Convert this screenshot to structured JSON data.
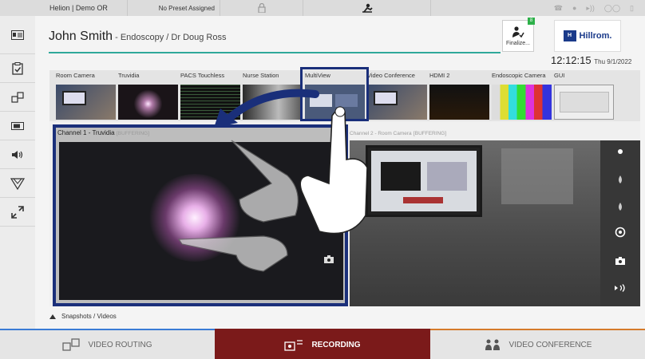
{
  "topbar": {
    "room": "Helion | Demo OR",
    "preset": "No Preset Assigned"
  },
  "header": {
    "patient_name": "John Smith",
    "procedure": " - Endoscopy / Dr Doug Ross",
    "finalize_label": "Finalize...",
    "finalize_badge": "8",
    "brand": "Hillrom.",
    "brand_mark": "H",
    "time": "12:12:15",
    "date": "Thu 9/1/2022"
  },
  "sources": [
    {
      "label": "Room Camera"
    },
    {
      "label": "Truvidia"
    },
    {
      "label": "PACS Touchless"
    },
    {
      "label": "Nurse Station"
    },
    {
      "label": "MultiView"
    },
    {
      "label": "Video Conference"
    },
    {
      "label": "HDMI 2"
    },
    {
      "label": "Endoscopic Camera"
    },
    {
      "label": "GUI"
    }
  ],
  "channels": {
    "ch1": {
      "title": "Channel 1 - Truvidia",
      "status": "[BUFFERING]"
    },
    "ch2": {
      "title": "Channel 2 - Room Camera",
      "status": "[BUFFERING]"
    }
  },
  "snapshots_label": "Snapshots / Videos",
  "bottom_tabs": {
    "routing": "VIDEO ROUTING",
    "recording": "RECORDING",
    "conference": "VIDEO CONFERENCE"
  },
  "colors": {
    "accent": "#1a2f7a",
    "recording": "#7b1a1a",
    "divider": "#2fa89a"
  },
  "icons": {
    "sidebar": [
      "patient-card-icon",
      "checklist-icon",
      "routing-icon",
      "display-icon",
      "speaker-icon",
      "lighting-icon",
      "expand-icon"
    ],
    "topbar": [
      "lock-icon",
      "surgeon-icon",
      "phone-icon",
      "record-dot-icon",
      "broadcast-icon",
      "glasses-icon",
      "battery-icon"
    ],
    "ch2_controls": [
      "dot-icon",
      "drop-icon",
      "drop-icon",
      "camera-switch-icon",
      "snapshot-icon",
      "stream-icon"
    ]
  }
}
